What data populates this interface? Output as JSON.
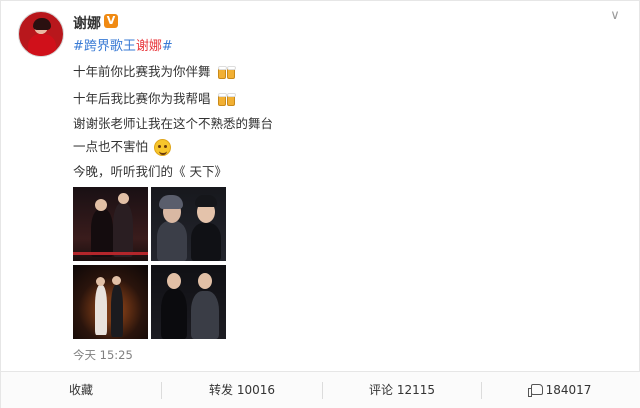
{
  "user": {
    "name": "谢娜"
  },
  "post": {
    "topic_prefix": "#跨界歌王",
    "topic_highlight": "谢娜",
    "topic_suffix": "#",
    "lines": [
      "十年前你比赛我为你伴舞",
      "十年后我比赛你为我帮唱",
      "谢谢张老师让我在这个不熟悉的舞台",
      "一点也不害怕",
      "今晚，听听我们的《 天下》"
    ],
    "time": "今天 15:25"
  },
  "icons": {
    "verified": "verified-v-icon",
    "more": "chevron-down-icon",
    "emoji_1": "beer-cheers-icon",
    "emoji_2": "beer-cheers-icon",
    "emoji_4": "smile-icon",
    "like": "thumbs-up-icon"
  },
  "actions": {
    "favorite": "收藏",
    "repost": "转发 10016",
    "comment": "评论 12115",
    "like": "184017"
  },
  "colors": {
    "link": "#3a7bd5",
    "highlight": "#e8353a",
    "verified": "#f08a13"
  }
}
